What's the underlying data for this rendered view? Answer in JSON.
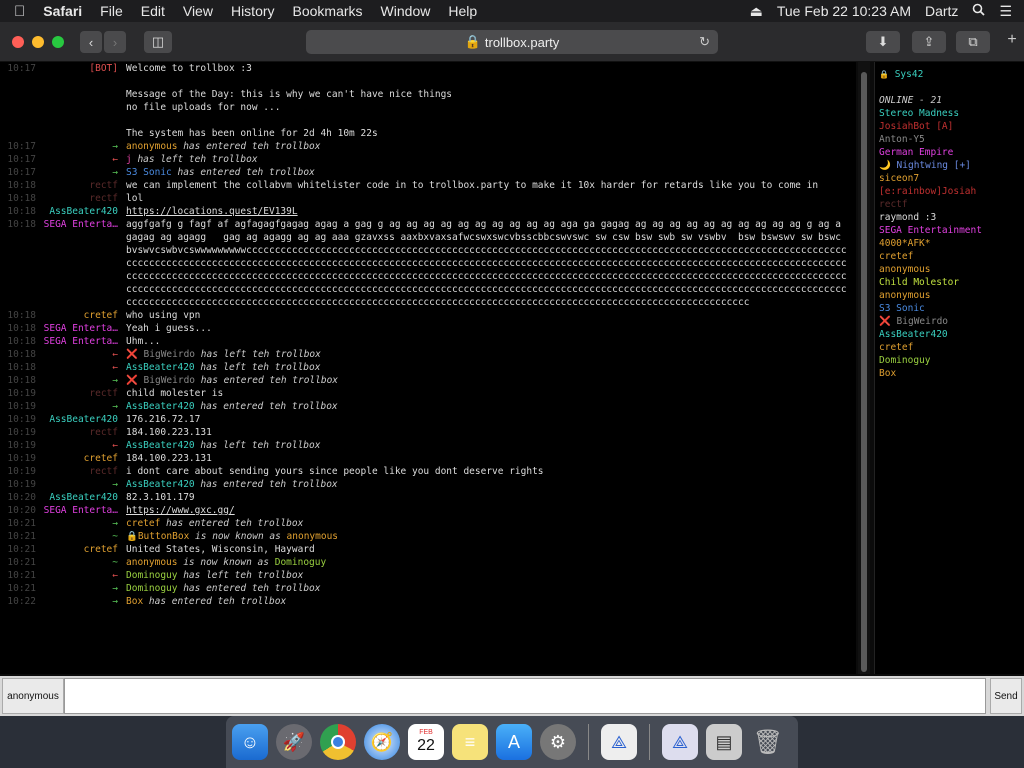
{
  "menubar": {
    "apple": "",
    "app": "Safari",
    "menus": [
      "File",
      "Edit",
      "View",
      "History",
      "Bookmarks",
      "Window",
      "Help"
    ],
    "datetime": "Tue Feb 22  10:23 AM",
    "user": "Dartz"
  },
  "browser": {
    "url": "trollbox.party"
  },
  "chat": [
    {
      "ts": "10:17",
      "nick": "[BOT]",
      "nick_color": "#e05050",
      "msg": "Welcome to trollbox :3",
      "msg_color": "#ddd"
    },
    {
      "ts": "",
      "nick": "",
      "nick_color": "#ddd",
      "msg": "",
      "msg_color": "#ddd"
    },
    {
      "ts": "",
      "nick": "",
      "nick_color": "#ddd",
      "msg": "Message of the Day: this is why we can't have nice things",
      "msg_color": "#ddd"
    },
    {
      "ts": "",
      "nick": "",
      "nick_color": "#ddd",
      "msg": "no file uploads for now ...",
      "msg_color": "#ddd"
    },
    {
      "ts": "",
      "nick": "",
      "nick_color": "#ddd",
      "msg": "",
      "msg_color": "#ddd"
    },
    {
      "ts": "",
      "nick": "",
      "nick_color": "#ddd",
      "msg": "The system has been online for 2d 4h 10m 22s",
      "msg_color": "#ddd"
    },
    {
      "ts": "10:17",
      "nick": "→",
      "nick_color": "#5ac85a",
      "user": "anonymous",
      "user_color": "#e0a030",
      "msg": " has entered teh trollbox",
      "italic": true
    },
    {
      "ts": "10:17",
      "nick": "←",
      "nick_color": "#e05050",
      "user": "j",
      "user_color": "#e040a0",
      "msg": " has left teh trollbox",
      "italic": true
    },
    {
      "ts": "10:17",
      "nick": "→",
      "nick_color": "#5ac85a",
      "user": "S3 Sonic",
      "user_color": "#4a8ae0",
      "msg": " has entered teh trollbox",
      "italic": true
    },
    {
      "ts": "10:18",
      "nick": "rectf",
      "nick_color": "#5a2a2a",
      "msg": "we can implement the collabvm whitelister code in to trollbox.party to make it 10x harder for retards like you to come in",
      "msg_color": "#ddd"
    },
    {
      "ts": "10:18",
      "nick": "rectf",
      "nick_color": "#5a2a2a",
      "msg": "lol",
      "msg_color": "#ddd"
    },
    {
      "ts": "10:18",
      "nick": "AssBeater420",
      "nick_color": "#3ad0c0",
      "msg": "https://locations.quest/EV139L",
      "msg_color": "#ddd",
      "link": true
    },
    {
      "ts": "10:18",
      "nick": "SEGA Enterta…",
      "nick_color": "#e040e0",
      "msg": "aggfgafg g fagf af agfagagfgagag agag a gag g ag ag ag ag ag ag ag ag ag ag aga ga gagag ag ag ag ag ag ag ag ag ag ag g ag a gagag ag agagg   gag ag agagg ag ag aaa gzavxss aaxbxvaxsafwcswxswcvbsscbbcswvswc sw csw bsw swb sw vswbv  bsw bswswv sw bswc",
      "msg_color": "#ddd"
    },
    {
      "ts": "",
      "nick": "",
      "nick_color": "#ddd",
      "msg": "bvswvcswbvcswwwwwwwwwcccccccccccccccccccccccccccccccccccccccccccccccccccccccccccccccccccccccccccccccccccccccccccccccccccccccccccccccccccccccccccccccccccccccccccccccccccccccccccccccccccccccccccccccccccccccccccccccccccccccccccccccccccccccccccccccccccccccccccccccccccccccccccccccccccccccccccccccccccccccccccccccccccccccccccccccccccccccccccccccccccccccccccccccccccccccccccccccccccccccccccccccccccccccccccccccccccccccccccccccccccccccccccccccccccccccccccccccccccccccccccccccccccccccccccccccccccccccccccccccccccccccccccccccccccccccccccccccccccccccccccccccccccccccccccccccccccccccccccccccccccccccccccccccccccccccccccccccc",
      "msg_color": "#ddd"
    },
    {
      "ts": "10:18",
      "nick": "cretef",
      "nick_color": "#e0a030",
      "msg": "who using vpn",
      "msg_color": "#ddd"
    },
    {
      "ts": "10:18",
      "nick": "SEGA Enterta…",
      "nick_color": "#e040e0",
      "msg": "Yeah i guess...",
      "msg_color": "#ddd"
    },
    {
      "ts": "10:18",
      "nick": "SEGA Enterta…",
      "nick_color": "#e040e0",
      "msg": "Uhm...",
      "msg_color": "#ddd"
    },
    {
      "ts": "10:18",
      "nick": "←",
      "nick_color": "#e05050",
      "user": "❌ BigWeirdo",
      "user_color": "#888",
      "msg": " has left teh trollbox",
      "italic": true
    },
    {
      "ts": "10:18",
      "nick": "←",
      "nick_color": "#e05050",
      "user": "AssBeater420",
      "user_color": "#3ad0c0",
      "msg": " has left teh trollbox",
      "italic": true
    },
    {
      "ts": "10:18",
      "nick": "→",
      "nick_color": "#5ac85a",
      "user": "❌ BigWeirdo",
      "user_color": "#888",
      "msg": " has entered teh trollbox",
      "italic": true
    },
    {
      "ts": "10:19",
      "nick": "rectf",
      "nick_color": "#5a2a2a",
      "msg": "child molester is",
      "msg_color": "#ddd"
    },
    {
      "ts": "10:19",
      "nick": "→",
      "nick_color": "#5ac85a",
      "user": "AssBeater420",
      "user_color": "#3ad0c0",
      "msg": " has entered teh trollbox",
      "italic": true
    },
    {
      "ts": "10:19",
      "nick": "AssBeater420",
      "nick_color": "#3ad0c0",
      "msg": "176.216.72.17",
      "msg_color": "#ddd"
    },
    {
      "ts": "10:19",
      "nick": "rectf",
      "nick_color": "#5a2a2a",
      "msg": "184.100.223.131",
      "msg_color": "#ddd"
    },
    {
      "ts": "10:19",
      "nick": "←",
      "nick_color": "#e05050",
      "user": "AssBeater420",
      "user_color": "#3ad0c0",
      "msg": " has left teh trollbox",
      "italic": true
    },
    {
      "ts": "10:19",
      "nick": "cretef",
      "nick_color": "#e0a030",
      "msg": "184.100.223.131",
      "msg_color": "#ddd"
    },
    {
      "ts": "10:19",
      "nick": "rectf",
      "nick_color": "#5a2a2a",
      "msg": "i dont care about sending yours since people like you dont deserve rights",
      "msg_color": "#ddd"
    },
    {
      "ts": "10:19",
      "nick": "→",
      "nick_color": "#5ac85a",
      "user": "AssBeater420",
      "user_color": "#3ad0c0",
      "msg": " has entered teh trollbox",
      "italic": true
    },
    {
      "ts": "10:20",
      "nick": "AssBeater420",
      "nick_color": "#3ad0c0",
      "msg": "82.3.101.179",
      "msg_color": "#ddd"
    },
    {
      "ts": "10:20",
      "nick": "SEGA Enterta…",
      "nick_color": "#e040e0",
      "msg": "https://www.gxc.gg/",
      "msg_color": "#ddd",
      "link": true
    },
    {
      "ts": "10:21",
      "nick": "→",
      "nick_color": "#5ac85a",
      "user": "cretef",
      "user_color": "#e0a030",
      "msg": " has entered teh trollbox",
      "italic": true
    },
    {
      "ts": "10:21",
      "nick": "~",
      "nick_color": "#5ac85a",
      "user": "🔒ButtonBox",
      "user_color": "#e0a030",
      "msg": " is now known as ",
      "italic": true,
      "user2": "anonymous",
      "user2_color": "#e0a030"
    },
    {
      "ts": "10:21",
      "nick": "cretef",
      "nick_color": "#e0a030",
      "msg": "United States, Wisconsin, Hayward",
      "msg_color": "#ddd"
    },
    {
      "ts": "10:21",
      "nick": "~",
      "nick_color": "#5ac85a",
      "user": "anonymous",
      "user_color": "#e0a030",
      "msg": " is now known as ",
      "italic": true,
      "user2": "Dominoguy",
      "user2_color": "#9ad040"
    },
    {
      "ts": "10:21",
      "nick": "←",
      "nick_color": "#e05050",
      "user": "Dominoguy",
      "user_color": "#9ad040",
      "msg": " has left teh trollbox",
      "italic": true
    },
    {
      "ts": "10:21",
      "nick": "→",
      "nick_color": "#5ac85a",
      "user": "Dominoguy",
      "user_color": "#9ad040",
      "msg": " has entered teh trollbox",
      "italic": true
    },
    {
      "ts": "10:22",
      "nick": "→",
      "nick_color": "#5ac85a",
      "user": "Box",
      "user_color": "#e0a030",
      "msg": " has entered teh trollbox",
      "italic": true
    }
  ],
  "userlist": {
    "self": "Sys42",
    "online_label": "ONLINE - 21",
    "users": [
      {
        "name": "Stereo Madness",
        "color": "#3ad0c0"
      },
      {
        "name": "JosiahBot [A]",
        "color": "#c03030"
      },
      {
        "name": "Anton-Y5",
        "color": "#888888"
      },
      {
        "name": "German Empire",
        "color": "#e040e0"
      },
      {
        "name": "🌙 Nightwing [+]",
        "color": "#6a8ae0"
      },
      {
        "name": "siceon7",
        "color": "#e0a030"
      },
      {
        "name": "[e:rainbow]Josiah",
        "color": "#c03030"
      },
      {
        "name": "rectf",
        "color": "#5a2a2a"
      },
      {
        "name": "raymond :3",
        "color": "#dddddd"
      },
      {
        "name": "SEGA Entertainment",
        "color": "#e040e0"
      },
      {
        "name": "4000*AFK*",
        "color": "#e0a030"
      },
      {
        "name": "cretef",
        "color": "#e0a030"
      },
      {
        "name": "anonymous",
        "color": "#e0a030"
      },
      {
        "name": "Child Molestor",
        "color": "#c0e040"
      },
      {
        "name": "anonymous",
        "color": "#e0a030"
      },
      {
        "name": "S3 Sonic",
        "color": "#4a8ae0"
      },
      {
        "name": "❌ BigWeirdo",
        "color": "#888888"
      },
      {
        "name": "AssBeater420",
        "color": "#3ad0c0"
      },
      {
        "name": "cretef",
        "color": "#e0a030"
      },
      {
        "name": "Dominoguy",
        "color": "#9ad040"
      },
      {
        "name": "Box",
        "color": "#e0a030"
      }
    ]
  },
  "input": {
    "nick": "anonymous",
    "value": "",
    "send_label": "Send"
  },
  "dock": {
    "calendar_month": "FEB",
    "calendar_day": "22"
  }
}
